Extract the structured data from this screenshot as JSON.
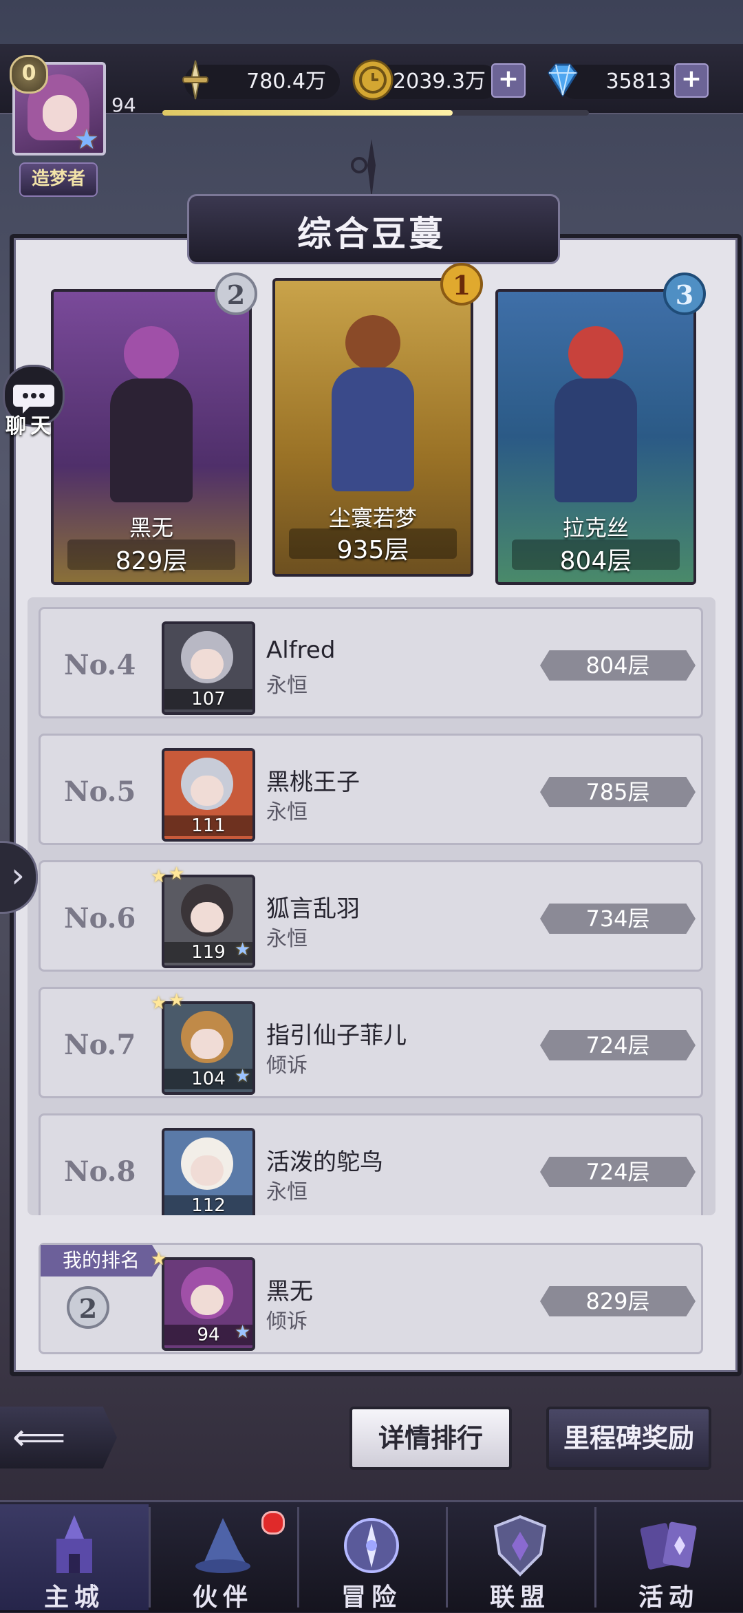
{
  "player": {
    "avatar_level_badge": "0",
    "level": "94",
    "title": "造梦者",
    "xp_progress": 0.68
  },
  "resources": {
    "power": "780.4万",
    "gold": "2039.3万",
    "diamonds": "35813",
    "plus": "+"
  },
  "panel": {
    "title": "综合豆蔓"
  },
  "top3": [
    {
      "rank": "2",
      "name": "黑无",
      "floor": "829层"
    },
    {
      "rank": "1",
      "name": "尘寰若梦",
      "floor": "935层"
    },
    {
      "rank": "3",
      "name": "拉克丝",
      "floor": "804层"
    }
  ],
  "ranking": [
    {
      "rank": "No.4",
      "name": "Alfred",
      "title": "永恒",
      "level": "107",
      "floor": "804层"
    },
    {
      "rank": "No.5",
      "name": "黑桃王子",
      "title": "永恒",
      "level": "111",
      "floor": "785层"
    },
    {
      "rank": "No.6",
      "name": "狐言乱羽",
      "title": "永恒",
      "level": "119",
      "floor": "734层"
    },
    {
      "rank": "No.7",
      "name": "指引仙子菲儿",
      "title": "倾诉",
      "level": "104",
      "floor": "724层"
    },
    {
      "rank": "No.8",
      "name": "活泼的鸵鸟",
      "title": "永恒",
      "level": "112",
      "floor": "724层"
    }
  ],
  "my_rank": {
    "tag": "我的排名",
    "rank": "2",
    "name": "黑无",
    "title": "倾诉",
    "level": "94",
    "floor": "829层"
  },
  "chat": {
    "label": "聊天"
  },
  "buttons": {
    "details": "详情排行",
    "milestone": "里程碑奖励"
  },
  "nav": [
    {
      "label": "主城",
      "icon": "castle-icon"
    },
    {
      "label": "伙伴",
      "icon": "wizard-hat-icon"
    },
    {
      "label": "冒险",
      "icon": "compass-portal-icon"
    },
    {
      "label": "联盟",
      "icon": "shield-icon"
    },
    {
      "label": "活动",
      "icon": "cards-icon"
    }
  ],
  "colors": {
    "gold_medal": "#e0a92e",
    "silver_medal": "#c9ccd6",
    "blue_medal": "#4f8fc4",
    "accent_purple": "#6c609a"
  }
}
